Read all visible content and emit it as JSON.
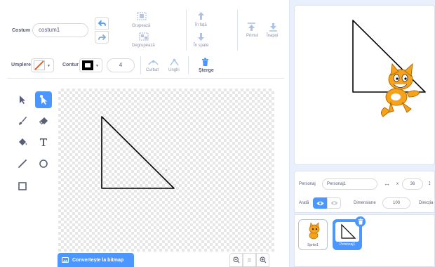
{
  "editor": {
    "costume_label": "Costum",
    "costume_name": "costum1",
    "group_label": "Grupează",
    "ungroup_label": "Degrupează",
    "forward_label": "În față",
    "backward_label": "În spate",
    "front_label": "Primul",
    "back_label": "Înapoi",
    "fill_label": "Umplere",
    "outline_label": "Contur",
    "outline_size": "4",
    "curved_label": "Curbat",
    "pointed_label": "Unghi",
    "delete_label": "Șterge",
    "fill_color": "#e8622b",
    "outline_color": "#000000"
  },
  "tools": [
    "select-icon",
    "reshape-icon",
    "brush-icon",
    "eraser-icon",
    "fill-icon",
    "text-icon",
    "line-icon",
    "circle-icon",
    "rectangle-icon"
  ],
  "canvas": {
    "convert_label": "Convertește la bitmap",
    "zoom_out": "−",
    "zoom_reset": "=",
    "zoom_in": "+"
  },
  "sprite_info": {
    "sprite_label": "Personaj",
    "sprite_name": "Personaj1",
    "x_label": "x",
    "x_value": "36",
    "show_label": "Arată",
    "size_label": "Dimensiune",
    "size_value": "100",
    "direction_label": "Direcția"
  },
  "sprites": [
    {
      "name": "Sprite1",
      "selected": false
    },
    {
      "name": "Personaj1",
      "selected": true
    }
  ],
  "colors": {
    "accent": "#4c97ff",
    "text": "#575e75",
    "panel_bg": "#e9f0fc"
  }
}
